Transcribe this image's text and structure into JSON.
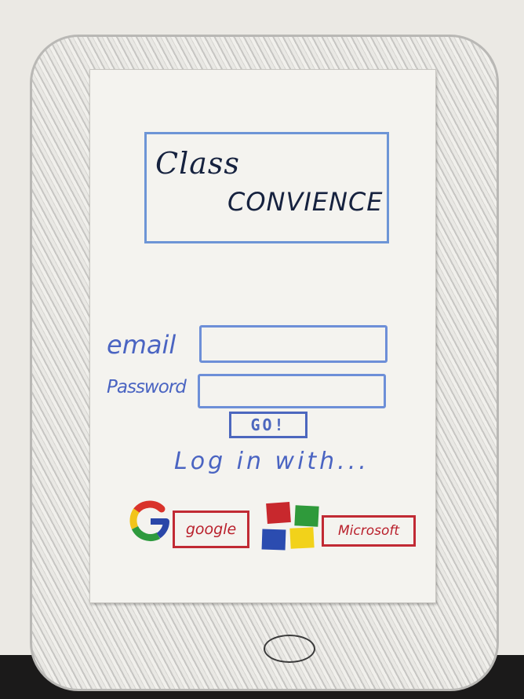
{
  "logo": {
    "line1": "Class",
    "line2": "CONVIENCE"
  },
  "login": {
    "email_label": "email",
    "email_value": "",
    "password_label": "Password",
    "password_value": "",
    "go_label": "GO!"
  },
  "social": {
    "heading": "Log in with...",
    "google_label": "google",
    "microsoft_label": "Microsoft"
  },
  "icons": {
    "google": "google-g-icon",
    "microsoft": "microsoft-squares-icon"
  },
  "colors": {
    "blue_ink": "#4a64c2",
    "red_ink": "#c12a34",
    "google_red": "#d9332b",
    "google_yellow": "#f2c41b",
    "google_green": "#2e9a3e",
    "google_blue": "#2a46a8",
    "ms_red": "#c8282d",
    "ms_green": "#2f9a3b",
    "ms_blue": "#2b4cb0",
    "ms_yellow": "#f2d21a"
  }
}
